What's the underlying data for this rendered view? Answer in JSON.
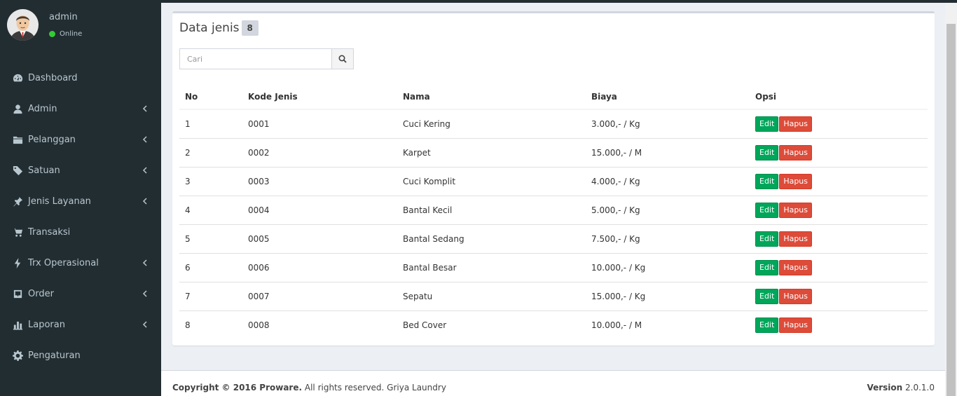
{
  "user": {
    "name": "admin",
    "status": "Online"
  },
  "menu": [
    {
      "label": "Dashboard",
      "icon": "dashboard-icon",
      "has_sub": false
    },
    {
      "label": "Admin",
      "icon": "user-icon",
      "has_sub": true
    },
    {
      "label": "Pelanggan",
      "icon": "folder-icon",
      "has_sub": true
    },
    {
      "label": "Satuan",
      "icon": "tag-icon",
      "has_sub": true
    },
    {
      "label": "Jenis Layanan",
      "icon": "pin-icon",
      "has_sub": true
    },
    {
      "label": "Transaksi",
      "icon": "cart-icon",
      "has_sub": false
    },
    {
      "label": "Trx Operasional",
      "icon": "bolt-icon",
      "has_sub": true
    },
    {
      "label": "Order",
      "icon": "inbox-icon",
      "has_sub": true
    },
    {
      "label": "Laporan",
      "icon": "bar-chart-icon",
      "has_sub": true
    },
    {
      "label": "Pengaturan",
      "icon": "gear-icon",
      "has_sub": false
    }
  ],
  "box": {
    "title": "Data jenis",
    "count": "8"
  },
  "search": {
    "placeholder": "Cari"
  },
  "table": {
    "headers": [
      "No",
      "Kode Jenis",
      "Nama",
      "Biaya",
      "Opsi"
    ],
    "rows": [
      [
        "1",
        "0001",
        "Cuci Kering",
        "3.000,- / Kg"
      ],
      [
        "2",
        "0002",
        "Karpet",
        "15.000,- / M"
      ],
      [
        "3",
        "0003",
        "Cuci Komplit",
        "4.000,- / Kg"
      ],
      [
        "4",
        "0004",
        "Bantal Kecil",
        "5.000,- / Kg"
      ],
      [
        "5",
        "0005",
        "Bantal Sedang",
        "7.500,- / Kg"
      ],
      [
        "6",
        "0006",
        "Bantal Besar",
        "10.000,- / Kg"
      ],
      [
        "7",
        "0007",
        "Sepatu",
        "15.000,- / Kg"
      ],
      [
        "8",
        "0008",
        "Bed Cover",
        "10.000,- / M"
      ]
    ],
    "edit_label": "Edit",
    "delete_label": "Hapus"
  },
  "footer": {
    "copyright_bold": "Copyright © 2016 Proware.",
    "copyright_rest": " All rights reserved. Griya Laundry",
    "version_label": "Version",
    "version_value": " 2.0.1.0"
  },
  "colors": {
    "sidebar": "#222d32",
    "edit": "#00a65a",
    "delete": "#dd4b39",
    "online": "#33cc33"
  }
}
